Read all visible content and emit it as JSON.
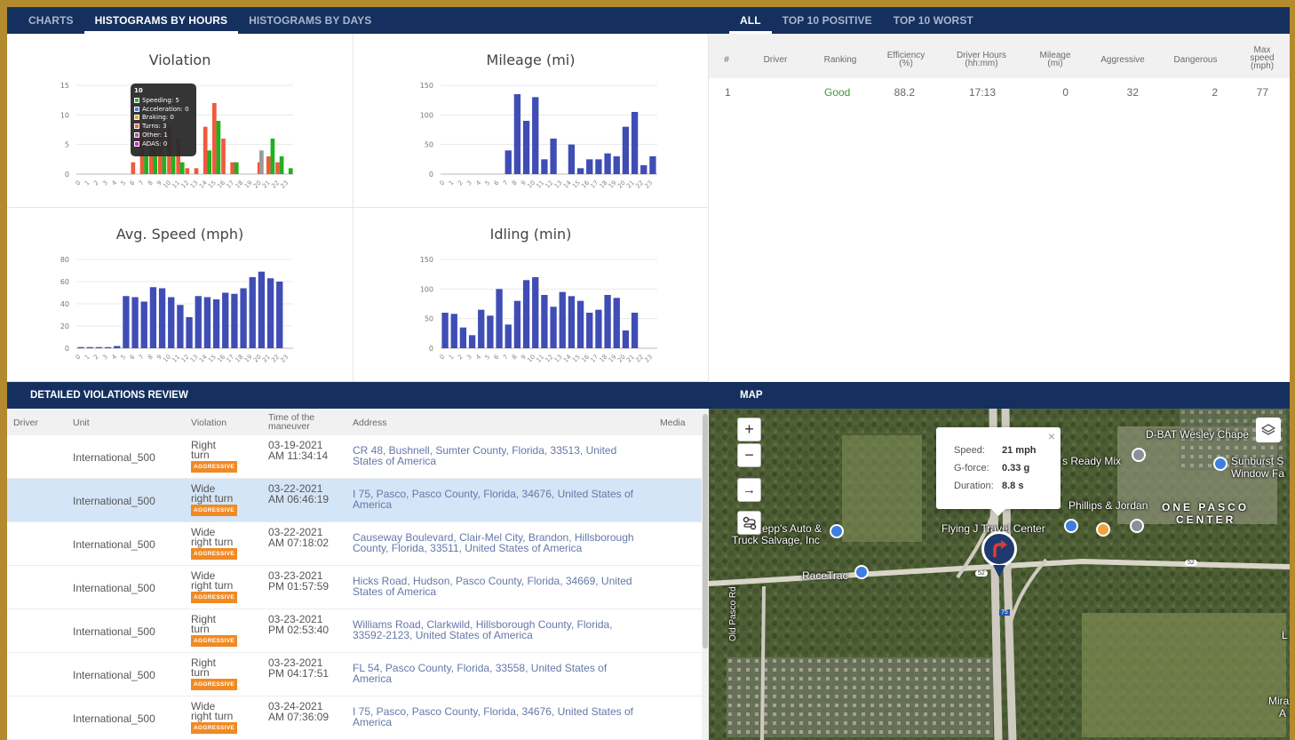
{
  "left_tabs": [
    "CHARTS",
    "HISTOGRAMS BY HOURS",
    "HISTOGRAMS BY DAYS"
  ],
  "right_tabs": [
    "ALL",
    "TOP 10 POSITIVE",
    "TOP 10 WORST"
  ],
  "hour_ticks": [
    "0",
    "1",
    "2",
    "3",
    "4",
    "5",
    "6",
    "7",
    "8",
    "9",
    "10",
    "11",
    "12",
    "13",
    "14",
    "15",
    "16",
    "17",
    "18",
    "19",
    "20",
    "21",
    "22",
    "23"
  ],
  "chart_data": [
    {
      "type": "bar",
      "title": "Violation",
      "ylim": [
        0,
        15
      ],
      "yticks": [
        0,
        5,
        10,
        15
      ],
      "series": [
        {
          "color": "#ef5a3c",
          "values": [
            0,
            0,
            0,
            0,
            0,
            0,
            2,
            8,
            10,
            7,
            8,
            6,
            1,
            1,
            8,
            12,
            6,
            2,
            0,
            0,
            2,
            3,
            2,
            0
          ]
        },
        {
          "color": "#20b020",
          "values": [
            0,
            0,
            0,
            0,
            0,
            0,
            0,
            3,
            5,
            3,
            3,
            2,
            0,
            0,
            4,
            9,
            0,
            2,
            0,
            0,
            0,
            6,
            3,
            1
          ]
        },
        {
          "color": "#999999",
          "values": [
            0,
            0,
            0,
            0,
            0,
            0,
            0,
            0,
            0,
            0,
            0,
            0,
            0,
            0,
            0,
            0,
            0,
            0,
            0,
            0,
            4,
            0,
            0,
            0
          ]
        }
      ]
    },
    {
      "type": "bar",
      "title": "Mileage (mi)",
      "ylim": [
        0,
        150
      ],
      "yticks": [
        0,
        50,
        100,
        150
      ],
      "values": [
        0,
        0,
        0,
        0,
        0,
        0,
        0,
        40,
        135,
        90,
        130,
        25,
        60,
        0,
        50,
        10,
        25,
        25,
        35,
        30,
        80,
        105,
        15,
        30
      ]
    },
    {
      "type": "bar",
      "title": "Avg. Speed (mph)",
      "ylim": [
        0,
        80
      ],
      "yticks": [
        0,
        20,
        40,
        60,
        80
      ],
      "values": [
        1,
        1,
        1,
        1,
        2,
        47,
        46,
        42,
        55,
        54,
        46,
        39,
        28,
        47,
        46,
        44,
        50,
        49,
        54,
        64,
        69,
        63,
        60,
        0
      ]
    },
    {
      "type": "bar",
      "title": "Idling (min)",
      "ylim": [
        0,
        150
      ],
      "yticks": [
        0,
        50,
        100,
        150
      ],
      "values": [
        60,
        58,
        35,
        22,
        65,
        55,
        100,
        40,
        80,
        115,
        120,
        90,
        70,
        95,
        88,
        80,
        60,
        65,
        90,
        85,
        30,
        60,
        0,
        0
      ]
    }
  ],
  "tooltip": {
    "header": "10",
    "rows": [
      {
        "color": "#20b020",
        "text": "Speeding: 5"
      },
      {
        "color": "#3a7bd5",
        "text": "Acceleration: 0"
      },
      {
        "color": "#f0a020",
        "text": "Braking: 0"
      },
      {
        "color": "#ef5a3c",
        "text": "Turns: 3"
      },
      {
        "color": "#b050a0",
        "text": "Other: 1"
      },
      {
        "color": "#d020d0",
        "text": "ADAS: 0"
      }
    ]
  },
  "top_table": {
    "headers": [
      "#",
      "Driver",
      "Ranking",
      "Efficiency (%)",
      "Driver Hours (hh:mm)",
      "Mileage (mi)",
      "Aggressive",
      "Dangerous",
      "Max speed (mph)"
    ],
    "row": {
      "index": "1",
      "driver": "",
      "ranking": "Good",
      "efficiency": "88.2",
      "hours": "17:13",
      "mileage": "0",
      "aggressive": "32",
      "dangerous": "2",
      "max_speed": "77"
    }
  },
  "violations": {
    "title": "DETAILED VIOLATIONS REVIEW",
    "headers": [
      "Driver",
      "Unit",
      "Violation",
      "Time of the maneuver",
      "Address",
      "Media"
    ],
    "badge": "AGGRESSIVE",
    "rows": [
      {
        "unit": "International_500",
        "violation": "Right turn",
        "time": "03-19-2021 AM 11:34:14",
        "address": "CR 48, Bushnell, Sumter County, Florida, 33513, United States of America"
      },
      {
        "unit": "International_500",
        "violation": "Wide right turn",
        "time": "03-22-2021 AM 06:46:19",
        "address": "I 75, Pasco, Pasco County, Florida, 34676, United States of America"
      },
      {
        "unit": "International_500",
        "violation": "Wide right turn",
        "time": "03-22-2021 AM 07:18:02",
        "address": "Causeway Boulevard, Clair-Mel City, Brandon, Hillsborough County, Florida, 33511, United States of America"
      },
      {
        "unit": "International_500",
        "violation": "Wide right turn",
        "time": "03-23-2021 PM 01:57:59",
        "address": "Hicks Road, Hudson, Pasco County, Florida, 34669, United States of America"
      },
      {
        "unit": "International_500",
        "violation": "Right turn",
        "time": "03-23-2021 PM 02:53:40",
        "address": "Williams Road, Clarkwild, Hillsborough County, Florida, 33592-2123, United States of America"
      },
      {
        "unit": "International_500",
        "violation": "Right turn",
        "time": "03-23-2021 PM 04:17:51",
        "address": "FL 54, Pasco County, Florida, 33558, United States of America"
      },
      {
        "unit": "International_500",
        "violation": "Wide right turn",
        "time": "03-24-2021 AM 07:36:09",
        "address": "I 75, Pasco, Pasco County, Florida, 34676, United States of America"
      }
    ]
  },
  "map": {
    "title": "MAP",
    "zoom_in": "+",
    "zoom_out": "−",
    "arrow": "→",
    "popup": {
      "speed_label": "Speed:",
      "speed": "21 mph",
      "gforce_label": "G-force:",
      "gforce": "0.33 g",
      "duration_label": "Duration:",
      "duration": "8.8 s",
      "close": "×"
    },
    "labels": [
      "D-BAT Wesley Chape",
      "s Ready Mix",
      "Sunburst S",
      "Window Fa",
      "Phillips & Jordan",
      "ONE PASCO",
      "CENTER",
      "epp's Auto &",
      "Truck Salvage, Inc",
      "Flying J Travel Center",
      "RaceTrac",
      "Old Pasco Rd",
      "Mira",
      "A",
      "L",
      "52",
      "52",
      "75"
    ]
  }
}
